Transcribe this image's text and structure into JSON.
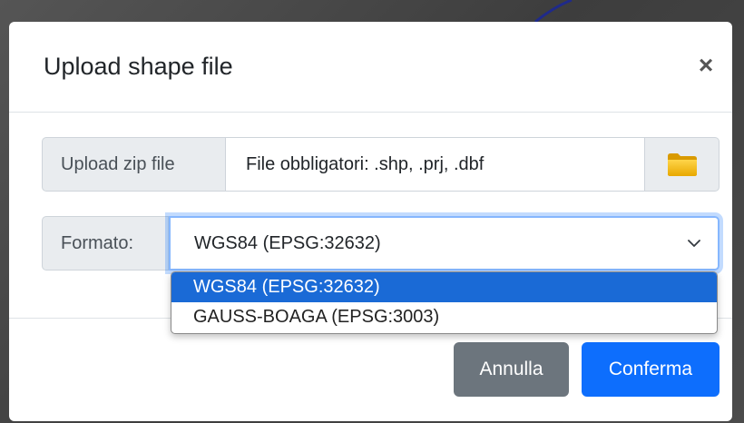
{
  "dialog": {
    "title": "Upload shape file",
    "close_label": "×"
  },
  "upload": {
    "label": "Upload zip file",
    "placeholder_text": "File obbligatori: .shp, .prj, .dbf",
    "browse_icon": "folder-icon"
  },
  "format": {
    "label": "Formato:",
    "selected_value": "WGS84 (EPSG:32632)",
    "options": [
      "WGS84 (EPSG:32632)",
      "GAUSS-BOAGA (EPSG:3003)"
    ],
    "highlighted_index": 0
  },
  "footer": {
    "cancel_label": "Annulla",
    "confirm_label": "Conferma"
  },
  "colors": {
    "primary": "#0d6efd",
    "secondary": "#6c757d",
    "option_highlight": "#1a6ad6",
    "folder": "#f5b800"
  }
}
